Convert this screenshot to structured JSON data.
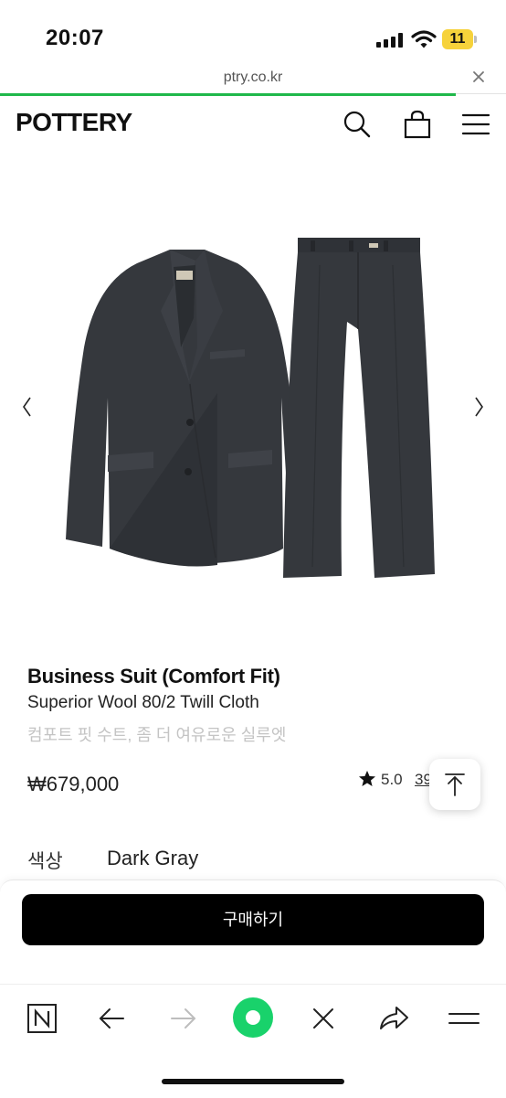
{
  "status_bar": {
    "time": "20:07",
    "battery": "11"
  },
  "browser": {
    "url": "ptry.co.kr",
    "load_progress": 0.9
  },
  "header": {
    "logo": "POTTERY",
    "icons": [
      "search-icon",
      "bag-icon",
      "menu-icon"
    ]
  },
  "product": {
    "title": "Business Suit (Comfort Fit)",
    "subtitle": "Superior Wool 80/2 Twill Cloth",
    "description_ko": "컴포트 핏 수트, 좀 더 여유로운 실루엣",
    "price": "₩679,000",
    "rating": "5.0",
    "review_count": "39",
    "color_label": "색상",
    "color_value": "Dark Gray",
    "suit_color": "#35383d"
  },
  "buy_button": {
    "label": "구매하기"
  },
  "toolbar": {
    "icons": [
      "naver-n-icon",
      "back-arrow-icon",
      "forward-arrow-icon",
      "green-dot-icon",
      "close-icon",
      "share-icon",
      "menu-lines-icon"
    ],
    "accent": "#19d26b"
  }
}
